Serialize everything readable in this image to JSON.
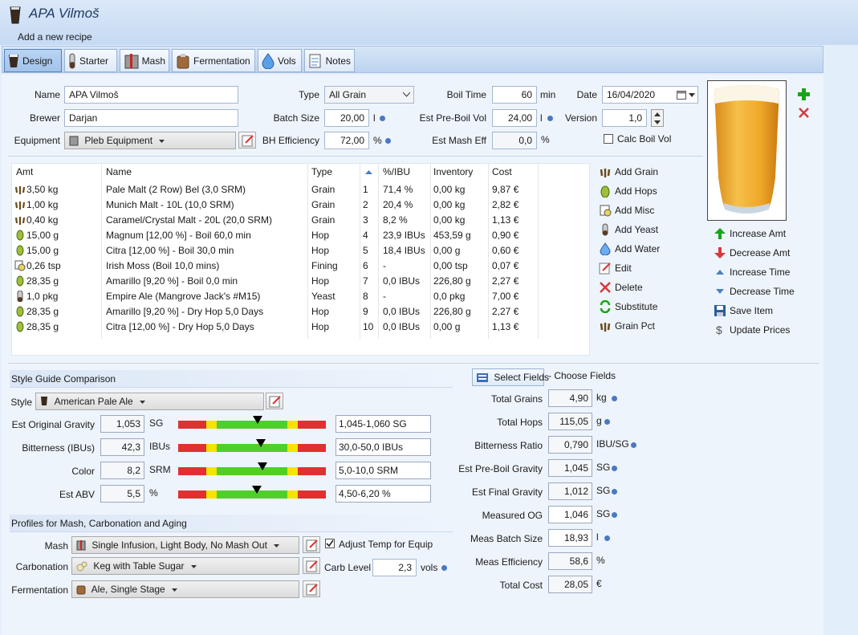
{
  "window": {
    "title": "APA Vilmoš",
    "subtitle": "Add a new recipe"
  },
  "tabs": [
    {
      "label": "Design",
      "icon": "beer-glass-icon"
    },
    {
      "label": "Starter",
      "icon": "starter-tube-icon"
    },
    {
      "label": "Mash",
      "icon": "mash-tun-icon"
    },
    {
      "label": "Fermentation",
      "icon": "fermenter-icon"
    },
    {
      "label": "Vols",
      "icon": "water-drop-icon"
    },
    {
      "label": "Notes",
      "icon": "notes-icon"
    }
  ],
  "form": {
    "name_label": "Name",
    "name_value": "APA Vilmoš",
    "brewer_label": "Brewer",
    "brewer_value": "Darjan",
    "equipment_label": "Equipment",
    "equipment_value": "Pleb Equipment",
    "type_label": "Type",
    "type_value": "All Grain",
    "batch_size_label": "Batch Size",
    "batch_size_value": "20,00",
    "batch_size_unit": "l",
    "bh_eff_label": "BH Efficiency",
    "bh_eff_value": "72,00",
    "bh_eff_unit": "%",
    "boil_time_label": "Boil Time",
    "boil_time_value": "60",
    "boil_time_unit": "min",
    "pre_boil_label": "Est Pre-Boil Vol",
    "pre_boil_value": "24,00",
    "pre_boil_unit": "l",
    "mash_eff_label": "Est Mash Eff",
    "mash_eff_value": "0,0",
    "mash_eff_unit": "%",
    "date_label": "Date",
    "date_value": "16/04/2020",
    "version_label": "Version",
    "version_value": "1,0",
    "calc_boil_label": "Calc Boil Vol"
  },
  "ingredients": {
    "columns": [
      "Amt",
      "Name",
      "Type",
      "",
      "%/IBU",
      "Inventory",
      "Cost"
    ],
    "rows": [
      {
        "icon": "grain",
        "amt": "3,50 kg",
        "name": "Pale Malt (2 Row) Bel (3,0 SRM)",
        "type": "Grain",
        "num": "1",
        "pct": "71,4 %",
        "inv": "0,00 kg",
        "cost": "9,87 €"
      },
      {
        "icon": "grain",
        "amt": "1,00 kg",
        "name": "Munich Malt - 10L (10,0 SRM)",
        "type": "Grain",
        "num": "2",
        "pct": "20,4 %",
        "inv": "0,00 kg",
        "cost": "2,82 €"
      },
      {
        "icon": "grain",
        "amt": "0,40 kg",
        "name": "Caramel/Crystal Malt - 20L (20,0 SRM)",
        "type": "Grain",
        "num": "3",
        "pct": "8,2 %",
        "inv": "0,00 kg",
        "cost": "1,13 €"
      },
      {
        "icon": "hop",
        "amt": "15,00 g",
        "name": "Magnum [12,00 %] - Boil 60,0 min",
        "type": "Hop",
        "num": "4",
        "pct": "23,9 IBUs",
        "inv": "453,59 g",
        "cost": "0,90 €"
      },
      {
        "icon": "hop",
        "amt": "15,00 g",
        "name": "Citra [12,00 %] - Boil 30,0 min",
        "type": "Hop",
        "num": "5",
        "pct": "18,4 IBUs",
        "inv": "0,00 g",
        "cost": "0,60 €"
      },
      {
        "icon": "misc",
        "amt": "0,26 tsp",
        "name": "Irish Moss (Boil 10,0 mins)",
        "type": "Fining",
        "num": "6",
        "pct": "-",
        "inv": "0,00 tsp",
        "cost": "0,07 €"
      },
      {
        "icon": "hop",
        "amt": "28,35 g",
        "name": "Amarillo [9,20 %] - Boil 0,0 min",
        "type": "Hop",
        "num": "7",
        "pct": "0,0 IBUs",
        "inv": "226,80 g",
        "cost": "2,27 €"
      },
      {
        "icon": "yeast",
        "amt": "1,0 pkg",
        "name": "Empire Ale (Mangrove Jack's #M15)",
        "type": "Yeast",
        "num": "8",
        "pct": "-",
        "inv": "0,0 pkg",
        "cost": "7,00 €"
      },
      {
        "icon": "hop",
        "amt": "28,35 g",
        "name": "Amarillo [9,20 %] - Dry Hop 5,0 Days",
        "type": "Hop",
        "num": "9",
        "pct": "0,0 IBUs",
        "inv": "226,80 g",
        "cost": "2,27 €"
      },
      {
        "icon": "hop",
        "amt": "28,35 g",
        "name": "Citra [12,00 %] - Dry Hop 5,0 Days",
        "type": "Hop",
        "num": "10",
        "pct": "0,0 IBUs",
        "inv": "0,00 g",
        "cost": "1,13 €"
      }
    ]
  },
  "actions": [
    "Add Grain",
    "Add Hops",
    "Add Misc",
    "Add Yeast",
    "Add Water",
    "Edit",
    "Delete",
    "Substitute",
    "Grain Pct"
  ],
  "right_actions": [
    "Increase Amt",
    "Decrease Amt",
    "Increase Time",
    "Decrease Time",
    "Save Item",
    "Update Prices"
  ],
  "style_guide": {
    "header": "Style Guide Comparison",
    "style_label": "Style",
    "style_value": "American Pale Ale",
    "rows": [
      {
        "label": "Est Original Gravity",
        "value": "1,053",
        "unit": "SG",
        "range": "1,045-1,060 SG",
        "marker": 0.54
      },
      {
        "label": "Bitterness (IBUs)",
        "value": "42,3",
        "unit": "IBUs",
        "range": "30,0-50,0 IBUs",
        "marker": 0.56
      },
      {
        "label": "Color",
        "value": "8,2",
        "unit": "SRM",
        "range": "5,0-10,0 SRM",
        "marker": 0.57
      },
      {
        "label": "Est ABV",
        "value": "5,5",
        "unit": "%",
        "range": "4,50-6,20 %",
        "marker": 0.53
      }
    ]
  },
  "profiles": {
    "header": "Profiles for Mash, Carbonation and Aging",
    "mash_label": "Mash",
    "mash_value": "Single Infusion, Light Body, No Mash Out",
    "carb_label": "Carbonation",
    "carb_value": "Keg with Table Sugar",
    "ferm_label": "Fermentation",
    "ferm_value": "Ale, Single Stage",
    "adjust_label": "Adjust Temp for Equip",
    "carb_level_label": "Carb Level",
    "carb_level_value": "2,3",
    "carb_level_unit": "vols"
  },
  "stats": {
    "select_fields_label": "Select Fields",
    "choose_fields_label": "- Choose Fields",
    "rows": [
      {
        "label": "Total Grains",
        "value": "4,90",
        "unit": "kg",
        "dot": true
      },
      {
        "label": "Total Hops",
        "value": "115,05",
        "unit": "g",
        "dot": true
      },
      {
        "label": "Bitterness Ratio",
        "value": "0,790",
        "unit": "IBU/SG",
        "dot": true
      },
      {
        "label": "Est Pre-Boil Gravity",
        "value": "1,045",
        "unit": "SG",
        "dot": true
      },
      {
        "label": "Est Final Gravity",
        "value": "1,012",
        "unit": "SG",
        "dot": true
      },
      {
        "label": "Measured OG",
        "value": "1,046",
        "unit": "SG",
        "dot": true,
        "editable": true
      },
      {
        "label": "Meas Batch Size",
        "value": "18,93",
        "unit": "l",
        "dot": true,
        "editable": true
      },
      {
        "label": "Meas Efficiency",
        "value": "58,6",
        "unit": "%",
        "dot": false
      },
      {
        "label": "Total Cost",
        "value": "28,05",
        "unit": "€",
        "dot": false
      }
    ]
  },
  "colors": {
    "accent": "#4a78c2",
    "bar_red": "#e03030",
    "bar_yellow": "#f5e400",
    "bar_green": "#4fcf2a",
    "add_green": "#1aa31a",
    "delete_red": "#d63a3a"
  }
}
